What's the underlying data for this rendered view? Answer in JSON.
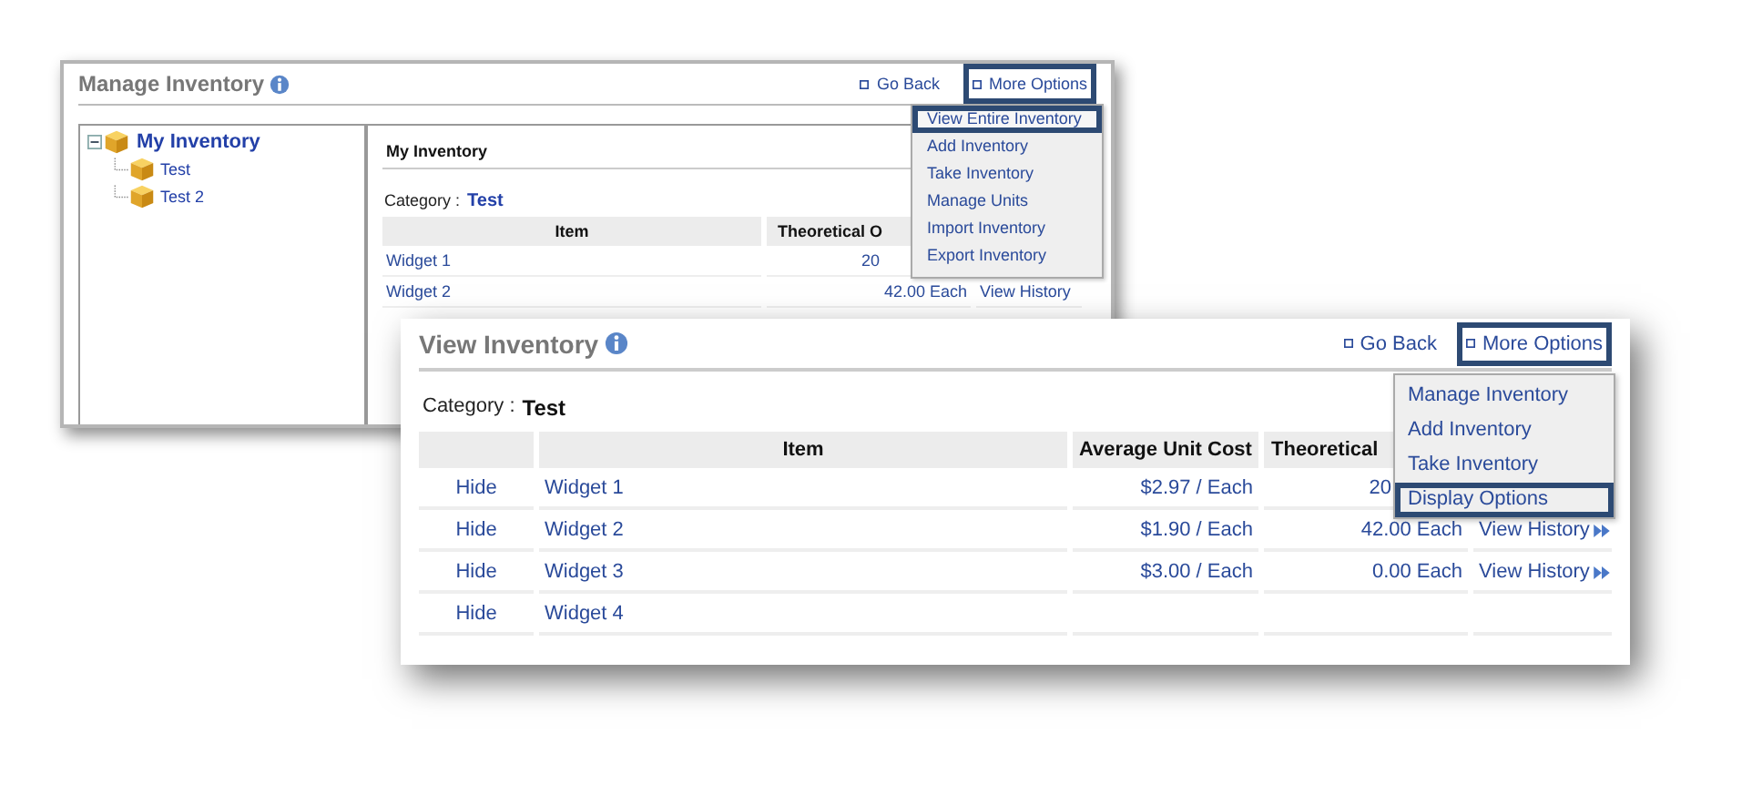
{
  "back_window": {
    "title": "Manage Inventory",
    "links": [
      {
        "label": "Go Back",
        "highlighted": false
      },
      {
        "label": "More Options",
        "highlighted": true
      }
    ],
    "menu": [
      {
        "label": "View Entire Inventory",
        "selected": true
      },
      {
        "label": "Add Inventory",
        "selected": false
      },
      {
        "label": "Take Inventory",
        "selected": false
      },
      {
        "label": "Manage Units",
        "selected": false
      },
      {
        "label": "Import Inventory",
        "selected": false
      },
      {
        "label": "Export Inventory",
        "selected": false
      }
    ],
    "tree": {
      "label": "My Inventory",
      "expanded": true,
      "children": [
        {
          "label": "Test"
        },
        {
          "label": "Test 2"
        }
      ]
    },
    "panel_title": "My Inventory",
    "category_label": "Category :",
    "category": "Test",
    "table": {
      "columns": [
        "Item",
        "Theoretical O"
      ],
      "rows": [
        {
          "item": "Widget 1",
          "quantity": "20"
        },
        {
          "item": "Widget 2",
          "quantity": "42.00 Each",
          "history": "View History"
        }
      ]
    }
  },
  "front_window": {
    "title": "View Inventory",
    "links": [
      {
        "label": "Go Back",
        "highlighted": false
      },
      {
        "label": "More Options",
        "highlighted": true
      }
    ],
    "menu": [
      {
        "label": "Manage Inventory",
        "selected": false
      },
      {
        "label": "Add Inventory",
        "selected": false
      },
      {
        "label": "Take Inventory",
        "selected": false
      },
      {
        "label": "Display Options",
        "selected": true
      }
    ],
    "category_label": "Category :",
    "category": "Test",
    "table": {
      "columns": [
        {},
        {
          "label": "Item"
        },
        {
          "label": "Average Unit Cost"
        },
        {
          "label": "Theoretical"
        },
        {}
      ],
      "rows": [
        {
          "action": "Hide",
          "item": "Widget 1",
          "cost": "$2.97 / Each",
          "quantity": "20"
        },
        {
          "action": "Hide",
          "item": "Widget 2",
          "cost": "$1.90 / Each",
          "quantity": "42.00 Each",
          "history": "View History"
        },
        {
          "action": "Hide",
          "item": "Widget 3",
          "cost": "$3.00 / Each",
          "quantity": "0.00 Each",
          "history": "View History"
        },
        {
          "action": "Hide",
          "item": "Widget 4"
        }
      ]
    }
  }
}
